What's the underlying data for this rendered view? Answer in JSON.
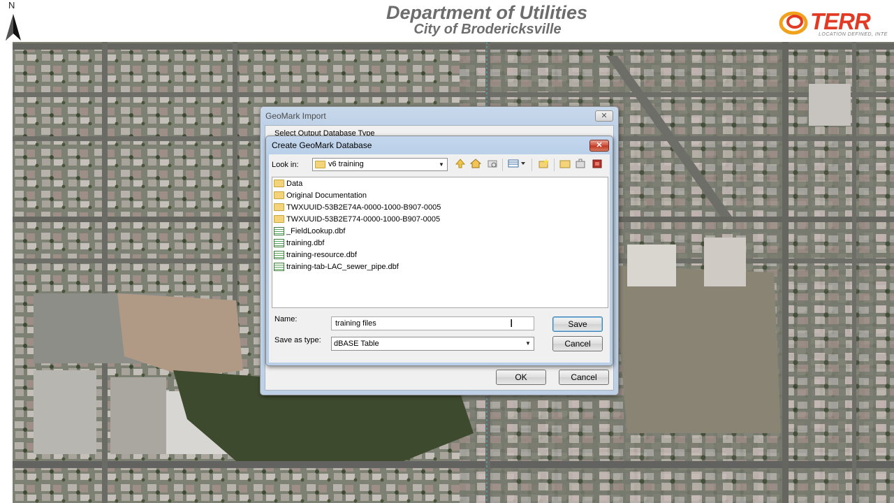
{
  "map": {
    "north_label": "N",
    "title": "Department of Utilities",
    "subtitle": "City of Brodericksville",
    "logo_text": "TERR",
    "logo_tagline": "LOCATION DEFINED, INTE"
  },
  "geomark_import": {
    "title": "GeoMark Import",
    "close_label": "✕",
    "output_label": "Select Output Database Type",
    "ok_label": "OK",
    "cancel_label": "Cancel"
  },
  "create_db": {
    "title": "Create GeoMark Database",
    "close_label": "✕",
    "look_in_label": "Look in:",
    "look_in_value": "v6 training",
    "toolbar_icons": [
      "up-one-level-icon",
      "home-icon",
      "connect-folder-icon",
      "view-menu-icon",
      "new-folder-icon",
      "folder-icon",
      "toolbox-icon",
      "geodatabase-icon"
    ],
    "files": [
      {
        "name": "Data",
        "kind": "folder"
      },
      {
        "name": "Original Documentation",
        "kind": "folder"
      },
      {
        "name": "TWXUUID-53B2E74A-0000-1000-B907-0005",
        "kind": "folder"
      },
      {
        "name": "TWXUUID-53B2E774-0000-1000-B907-0005",
        "kind": "folder"
      },
      {
        "name": "_FieldLookup.dbf",
        "kind": "table"
      },
      {
        "name": "training.dbf",
        "kind": "table"
      },
      {
        "name": "training-resource.dbf",
        "kind": "table"
      },
      {
        "name": "training-tab-LAC_sewer_pipe.dbf",
        "kind": "table"
      }
    ],
    "name_label": "Name:",
    "name_value": "training files",
    "type_label": "Save as type:",
    "type_value": "dBASE Table",
    "save_label": "Save",
    "cancel_label": "Cancel"
  }
}
